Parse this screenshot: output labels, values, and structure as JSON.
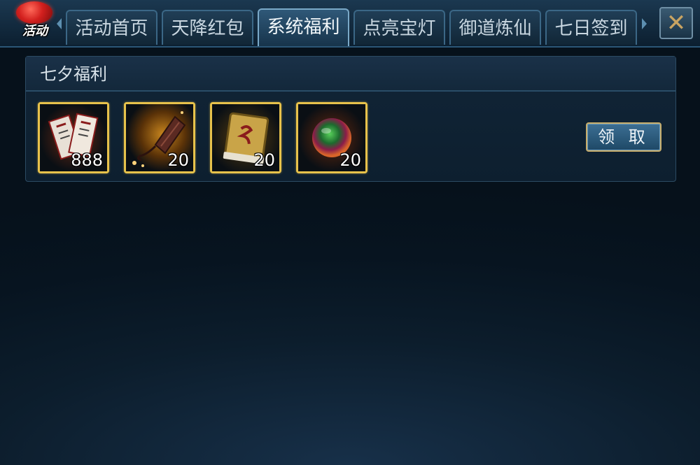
{
  "emblem": {
    "label": "活动"
  },
  "tabs": [
    {
      "label": "活动首页",
      "active": false
    },
    {
      "label": "天降红包",
      "active": false
    },
    {
      "label": "系统福利",
      "active": true
    },
    {
      "label": "点亮宝灯",
      "active": false
    },
    {
      "label": "御道炼仙",
      "active": false
    },
    {
      "label": "七日签到",
      "active": false
    }
  ],
  "panel": {
    "title": "七夕福利",
    "items": [
      {
        "icon": "talisman-cards-icon",
        "count": "888"
      },
      {
        "icon": "sword-scroll-icon",
        "count": "20"
      },
      {
        "icon": "skill-book-icon",
        "count": "20"
      },
      {
        "icon": "spirit-orb-icon",
        "count": "20"
      }
    ],
    "claim_label": "领 取"
  },
  "colors": {
    "item_border": "#e7c24b",
    "claim_border": "#c7ad6b",
    "tab_border": "#3b6786"
  }
}
